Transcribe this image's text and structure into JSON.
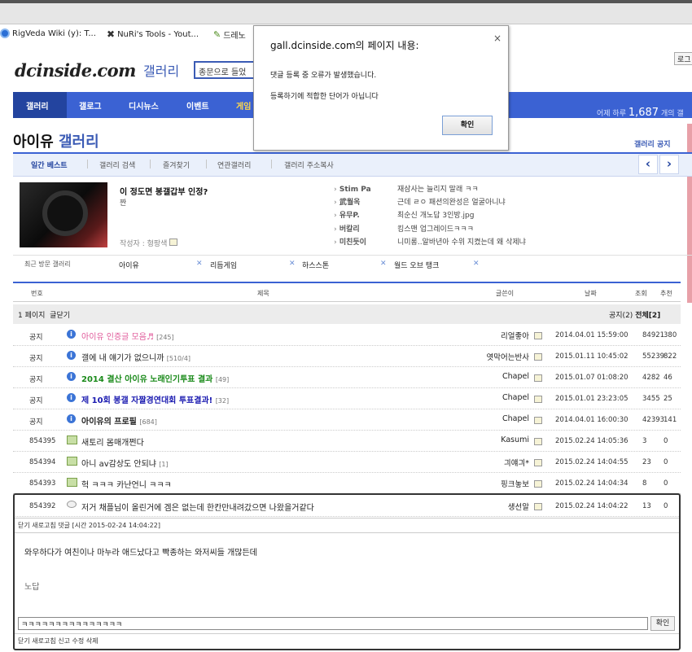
{
  "bookmarks": [
    "RigVeda Wiki (y): T...",
    "NuRi's Tools - Yout...",
    "드레노"
  ],
  "header": {
    "logo": "dcinside.com",
    "logo_sub": "갤러리",
    "search_value": "종문으로 들었",
    "top_button": "로그"
  },
  "nav": {
    "items": [
      "갤러리",
      "갤로그",
      "디시뉴스",
      "이벤트",
      "게임"
    ],
    "stat_label": "어제 하루",
    "stat_value": "1,687",
    "stat_suffix": "개의 갤"
  },
  "gallery": {
    "name": "아이유",
    "suffix": "갤러리",
    "notice": "갤러리 공지"
  },
  "tabs": [
    "일간 베스트",
    "갤러리 검색",
    "즐겨찾기",
    "연관갤러리",
    "갤러리 주소복사"
  ],
  "best": {
    "title": "이 정도면 봉갤갑부 인정?",
    "sub": "짠",
    "author": "작성자 : 형팡색"
  },
  "best_list": [
    {
      "name": "Stim Pa",
      "text": "재삼사는 늘리지 말래 ㅋㅋ"
    },
    {
      "name": "武월옥",
      "text": "근데 ㄹㅇ 패션의완성은 얼굴아니냐"
    },
    {
      "name": "유무P.",
      "text": "최순신 개노답 3인방.jpg"
    },
    {
      "name": "버칼리",
      "text": "킹스맨 업그레이드ㅋㅋㅋ"
    },
    {
      "name": "미친듯이",
      "text": "니미롱..알바년아 수위 지켰는데 왜 삭제냐"
    }
  ],
  "recent": {
    "label": "최근 방문 갤러리",
    "items": [
      "아이유",
      "리듬게임",
      "하스스톤",
      "월드 오브 탱크"
    ]
  },
  "table": {
    "headers": [
      "번호",
      "제목",
      "글쓴이",
      "날짜",
      "조회",
      "추천"
    ],
    "page_label": "1 페이지",
    "close_label": "글닫기",
    "notice_count": "공지(2)",
    "total": "전체[2]"
  },
  "rows": [
    {
      "no": "공지",
      "subject": "아이유 인증글 모음♬",
      "count": "[245]",
      "writer": "리얼좋아",
      "date": "2014.04.01 15:59:00",
      "views": "84921",
      "rec": "380",
      "color": "#e05a9a",
      "bold": false,
      "icon": "info"
    },
    {
      "no": "공지",
      "subject": "갤에 내 얘기가 없으니까",
      "count": "[510/4]",
      "writer": "엿막어는반사",
      "date": "2015.01.11 10:45:02",
      "views": "55239",
      "rec": "822",
      "color": "#222222",
      "bold": false,
      "icon": "info"
    },
    {
      "no": "공지",
      "subject": "2014 결산 아이유 노래인기투표 결과",
      "count": "[49]",
      "writer": "Chapel",
      "date": "2015.01.07 01:08:20",
      "views": "4282",
      "rec": "46",
      "color": "#1a8a1a",
      "bold": true,
      "icon": "info"
    },
    {
      "no": "공지",
      "subject": "제 10회 봉갤 자짤경연대회 투표결과!",
      "count": "[32]",
      "writer": "Chapel",
      "date": "2015.01.01 23:23:05",
      "views": "3455",
      "rec": "25",
      "color": "#1a1ab0",
      "bold": true,
      "icon": "info"
    },
    {
      "no": "공지",
      "subject": "아이유의 프로필",
      "count": "[684]",
      "writer": "Chapel",
      "date": "2014.04.01 16:00:30",
      "views": "42393",
      "rec": "141",
      "color": "#222222",
      "bold": true,
      "icon": "info"
    },
    {
      "no": "854395",
      "subject": "새토리 몸매개쩐다",
      "count": "",
      "writer": "Kasumi",
      "date": "2015.02.24 14:05:36",
      "views": "3",
      "rec": "0",
      "color": "#222222",
      "bold": false,
      "icon": "img"
    },
    {
      "no": "854394",
      "subject": "아니 av감상도 안되냐",
      "count": "[1]",
      "writer": "긔얘긔*",
      "date": "2015.02.24 14:04:55",
      "views": "23",
      "rec": "0",
      "color": "#222222",
      "bold": false,
      "icon": "img"
    },
    {
      "no": "854393",
      "subject": "헉 ㅋㅋㅋ 카난언니 ㅋㅋㅋ",
      "count": "",
      "writer": "핑크놓보",
      "date": "2015.02.24 14:04:34",
      "views": "8",
      "rec": "0",
      "color": "#222222",
      "bold": false,
      "icon": "img"
    },
    {
      "no": "854392",
      "subject": "저거 채플님이 올린거에 겜은 없는데 한칸만내려갔으면 나왔을거같다",
      "count": "",
      "writer": "생선알",
      "date": "2015.02.24 14:04:22",
      "views": "13",
      "rec": "0",
      "color": "#222222",
      "bold": false,
      "icon": "cmt"
    }
  ],
  "comment": {
    "head": "닫기 새로고침 댓글  [시간 2015-02-24 14:04:22]",
    "text": "와우하다가 여친이나 마누라 애드났다고 빡종하는 와저씨들 개많든데",
    "text2": "노답",
    "input_value": "ㅋㅋㅋㅋㅋㅋㅋㅋㅋㅋㅋㅋㅋㅋㅋ",
    "ok_label": "확인",
    "footer": "닫기 새로고침 신고 수정 삭제"
  },
  "dialog": {
    "title": "gall.dcinside.com의 페이지 내용:",
    "line1": "댓글 등록 중 오류가 발생했습니다.",
    "line2": "등록하기에 적합한 단어가 아닙니다",
    "ok_label": "확인",
    "close": "×"
  }
}
